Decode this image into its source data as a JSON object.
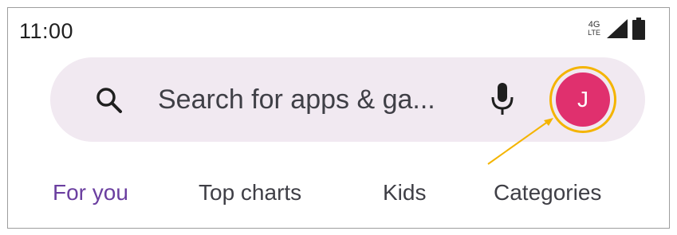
{
  "status_bar": {
    "time": "11:00",
    "network_top": "4G",
    "network_bottom": "LTE",
    "signal_icon": "signal-icon",
    "battery_icon": "battery-icon"
  },
  "search": {
    "placeholder": "Search for apps & ga...",
    "search_icon": "search-icon",
    "mic_icon": "mic-icon"
  },
  "account": {
    "avatar_initial": "J",
    "avatar_color": "#e0306e",
    "highlight_color": "#f4b400"
  },
  "tabs": [
    {
      "label": "For you",
      "active": true
    },
    {
      "label": "Top charts",
      "active": false
    },
    {
      "label": "Kids",
      "active": false
    },
    {
      "label": "Categories",
      "active": false
    }
  ],
  "colors": {
    "accent": "#6b3fa0",
    "search_bg": "#f1e9f1"
  }
}
